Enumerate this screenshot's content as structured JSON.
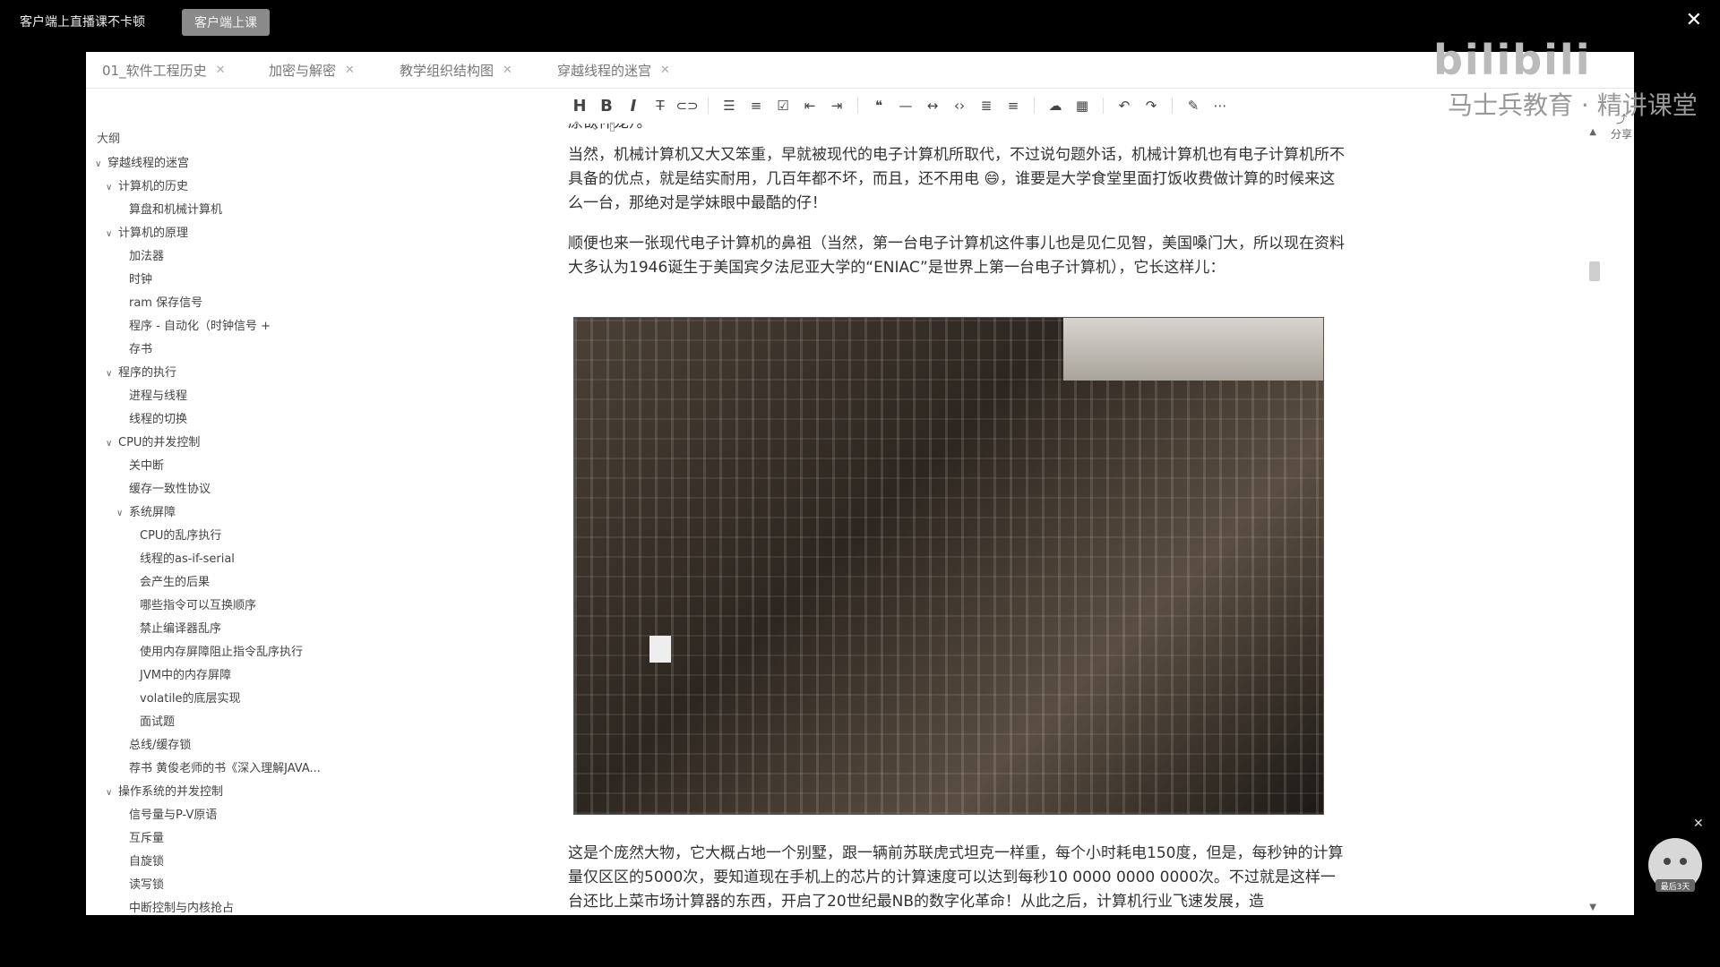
{
  "promo": {
    "text": "客户端上直播课不卡顿",
    "button": "客户端上课"
  },
  "tabs": [
    {
      "label": "01_软件工程历史"
    },
    {
      "label": "加密与解密"
    },
    {
      "label": "教学组织结构图"
    },
    {
      "label": "穿越线程的迷宫"
    }
  ],
  "toolbar": [
    "H",
    "B",
    "I",
    "S",
    "link",
    "ul",
    "ol",
    "task",
    "indent-dec",
    "indent-inc",
    "quote",
    "hr",
    "code",
    "code-inline",
    "align",
    "table-format",
    "cloud",
    "table",
    "undo",
    "redo",
    "pen",
    "more"
  ],
  "watermark": {
    "site": "bilibili",
    "brand": "马士兵教育 · 精讲课堂"
  },
  "share": "分享",
  "outline": {
    "title": "大纲",
    "items": [
      {
        "label": "穿越线程的迷宫",
        "level": 0,
        "caret": true
      },
      {
        "label": "计算机的历史",
        "level": 1,
        "caret": true
      },
      {
        "label": "算盘和机械计算机",
        "level": 2,
        "caret": false
      },
      {
        "label": "计算机的原理",
        "level": 1,
        "caret": true
      },
      {
        "label": "加法器",
        "level": 2,
        "caret": false
      },
      {
        "label": "时钟",
        "level": 2,
        "caret": false
      },
      {
        "label": "ram 保存信号",
        "level": 2,
        "caret": false
      },
      {
        "label": "程序 - 自动化（时钟信号 +",
        "level": 2,
        "caret": false
      },
      {
        "label": "存书",
        "level": 2,
        "caret": false
      },
      {
        "label": "程序的执行",
        "level": 1,
        "caret": true
      },
      {
        "label": "进程与线程",
        "level": 2,
        "caret": false
      },
      {
        "label": "线程的切换",
        "level": 2,
        "caret": false
      },
      {
        "label": "CPU的并发控制",
        "level": 1,
        "caret": true
      },
      {
        "label": "关中断",
        "level": 2,
        "caret": false
      },
      {
        "label": "缓存一致性协议",
        "level": 2,
        "caret": false
      },
      {
        "label": "系统屏障",
        "level": 2,
        "caret": true
      },
      {
        "label": "CPU的乱序执行",
        "level": 3,
        "caret": false
      },
      {
        "label": "线程的as-if-serial",
        "level": 3,
        "caret": false
      },
      {
        "label": "会产生的后果",
        "level": 3,
        "caret": false
      },
      {
        "label": "哪些指令可以互换顺序",
        "level": 3,
        "caret": false
      },
      {
        "label": "禁止编译器乱序",
        "level": 3,
        "caret": false
      },
      {
        "label": "使用内存屏障阻止指令乱序执行",
        "level": 3,
        "caret": false
      },
      {
        "label": "JVM中的内存屏障",
        "level": 3,
        "caret": false
      },
      {
        "label": "volatile的底层实现",
        "level": 3,
        "caret": false
      },
      {
        "label": "面试题",
        "level": 3,
        "caret": false
      },
      {
        "label": "总线/缓存锁",
        "level": 2,
        "caret": false
      },
      {
        "label": "荐书 黄俊老师的书《深入理解JAVA...",
        "level": 2,
        "caret": false
      },
      {
        "label": "操作系统的并发控制",
        "level": 1,
        "caret": true
      },
      {
        "label": "信号量与P-V原语",
        "level": 2,
        "caret": false
      },
      {
        "label": "互斥量",
        "level": 2,
        "caret": false
      },
      {
        "label": "自旋锁",
        "level": 2,
        "caret": false
      },
      {
        "label": "读写锁",
        "level": 2,
        "caret": false
      },
      {
        "label": "中断控制与内核抢占",
        "level": 2,
        "caret": false
      }
    ]
  },
  "content": {
    "clipped_line": "原欲仲宠）。",
    "p1": "当然，机械计算机又大又笨重，早就被现代的电子计算机所取代，不过说句题外话，机械计算机也有电子计算机所不具备的优点，就是结实耐用，几百年都不坏，而且，还不用电 😄，谁要是大学食堂里面打饭收费做计算的时候来这么一台，那绝对是学妹眼中最酷的仔！",
    "p2": "顺便也来一张现代电子计算机的鼻祖（当然，第一台电子计算机这件事儿也是见仁见智，美国嗓门大，所以现在资料大多认为1946诞生于美国宾夕法尼亚大学的“ENIAC”是世界上第一台电子计算机），它长这样儿：",
    "p3": "这是个庞然大物，它大概占地一个别墅，跟一辆前苏联虎式坦克一样重，每个小时耗电150度，但是，每秒钟的计算量仅区区的5000次，要知道现在手机上的芯片的计算速度可以达到每秒10 0000 0000 0000次。不过就是这样一台还比上菜市场计算器的东西，开启了20世纪最NB的数字化革命！从此之后，计算机行业飞速发展，造"
  },
  "mascot_badge": "最后3天"
}
